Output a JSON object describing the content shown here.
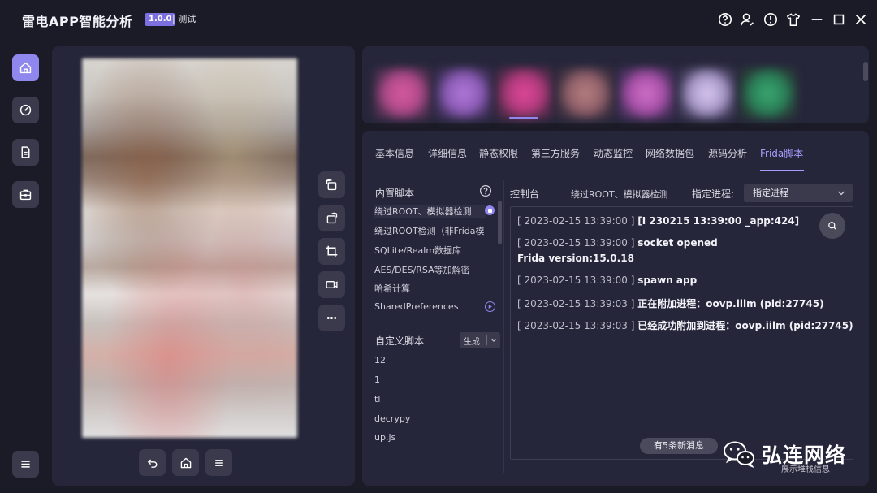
{
  "titlebar": {
    "title": "雷电APP智能分析",
    "version": "1.0.0",
    "env": "| 测试"
  },
  "main": {
    "tabs": [
      "基本信息",
      "详细信息",
      "静态权限",
      "第三方服务",
      "动态监控",
      "网络数据包",
      "源码分析",
      "Frida脚本"
    ],
    "active_tab": "Frida脚本"
  },
  "builtin": {
    "title": "内置脚本",
    "items": [
      "绕过ROOT、模拟器检测",
      "绕过ROOT检测（非Frida模",
      "SQLite/Realm数据库",
      "AES/DES/RSA等加解密",
      "哈希计算",
      "SharedPreferences"
    ]
  },
  "custom": {
    "title": "自定义脚本",
    "generate_label": "生成",
    "items": [
      "12",
      "1",
      "tl",
      "decrypy",
      "up.js"
    ]
  },
  "console": {
    "title": "控制台",
    "current_script": "绕过ROOT、模拟器检测",
    "process_label": "指定进程:",
    "process_value": "指定进程",
    "logs": [
      {
        "ts": "[ 2023-02-15 13:39:00 ]",
        "msg": "[I 230215 13:39:00 _app:424]"
      },
      {
        "ts": "[ 2023-02-15 13:39:00 ]",
        "msg": "socket opened"
      },
      {
        "ts": "",
        "msg": "Frida version:15.0.18"
      },
      {
        "ts": "[ 2023-02-15 13:39:00 ]",
        "msg": "spawn app"
      },
      {
        "ts": "[ 2023-02-15 13:39:03 ]",
        "msg": "正在附加进程：oovp.iilm (pid:27745)"
      },
      {
        "ts": "[ 2023-02-15 13:39:03 ]",
        "msg": "已经成功附加到进程：oovp.iilm (pid:27745)"
      }
    ],
    "new_messages": "有5条新消息"
  },
  "watermark": {
    "text": "弘连网络",
    "sub": "展示堆栈信息"
  },
  "colors": {
    "accent": "#8f86ee",
    "tab_active": "#a69eff",
    "panel": "#26263a",
    "background": "#1b1b27"
  },
  "icons": {
    "titlebar": [
      "help-circle-icon",
      "user-icon",
      "info-icon",
      "shirt-icon",
      "minimize-icon",
      "maximize-icon",
      "close-icon"
    ],
    "nav": [
      "home-icon",
      "dashboard-icon",
      "document-icon",
      "toolbox-icon",
      "menu-icon"
    ],
    "tools": [
      "rotate-left-icon",
      "rotate-right-icon",
      "crop-icon",
      "record-icon",
      "more-icon"
    ],
    "device": [
      "back-icon",
      "home-icon",
      "menu-icon"
    ]
  }
}
